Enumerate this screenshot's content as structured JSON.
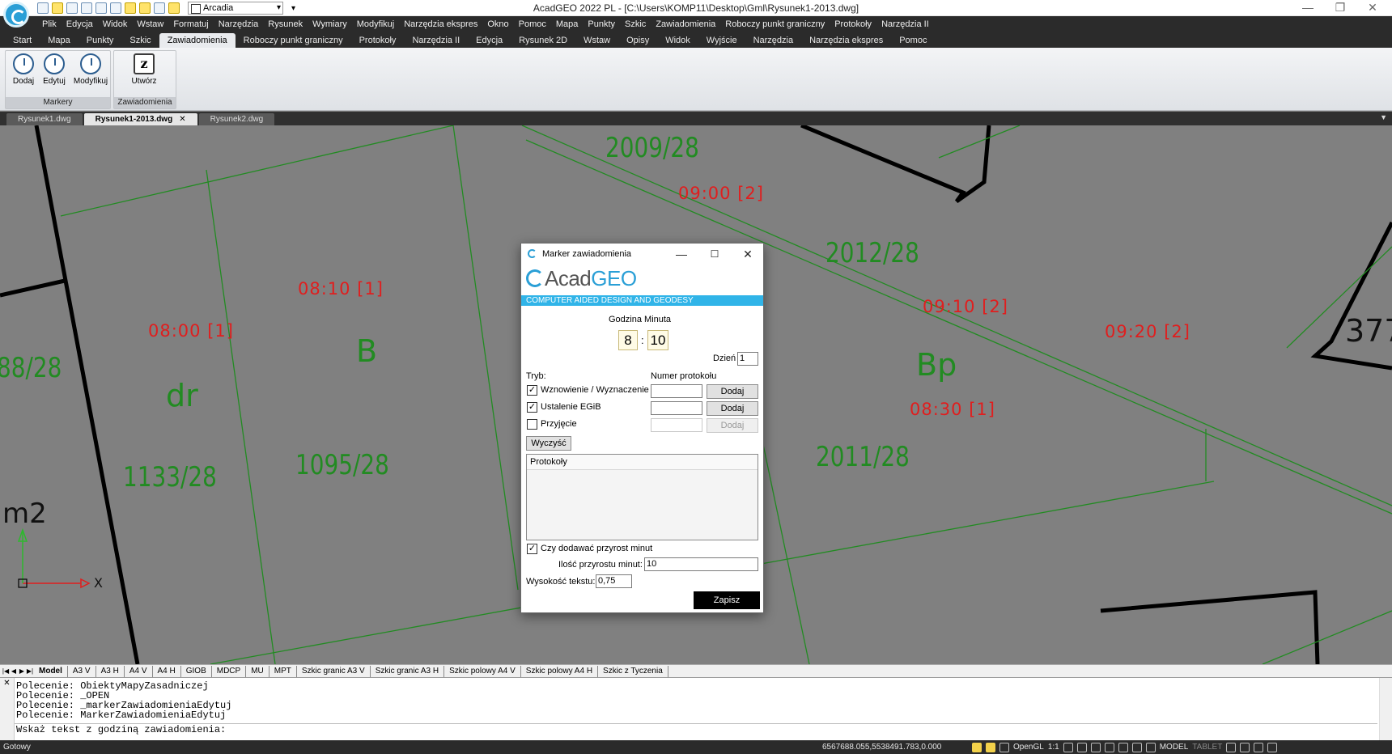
{
  "window": {
    "title": "AcadGEO 2022 PL - [C:\\Users\\KOMP11\\Desktop\\Gml\\Rysunek1-2013.dwg]",
    "layer_value": "Arcadia",
    "qat_more": "▾",
    "minimize": "—",
    "maximize": "❐",
    "close": "✕"
  },
  "menu": [
    "Plik",
    "Edycja",
    "Widok",
    "Wstaw",
    "Formatuj",
    "Narzędzia",
    "Rysunek",
    "Wymiary",
    "Modyfikuj",
    "Narzędzia ekspres",
    "Okno",
    "Pomoc",
    "Mapa",
    "Punkty",
    "Szkic",
    "Zawiadomienia",
    "Roboczy punkt graniczny",
    "Protokoły",
    "Narzędzia II"
  ],
  "ribbon_tabs": [
    "Start",
    "Mapa",
    "Punkty",
    "Szkic",
    "Zawiadomienia",
    "Roboczy punkt graniczny",
    "Protokoły",
    "Narzędzia II",
    "Edycja",
    "Rysunek 2D",
    "Wstaw",
    "Opisy",
    "Widok",
    "Wyjście",
    "Narzędzia",
    "Narzędzia ekspres",
    "Pomoc"
  ],
  "ribbon": {
    "markery": {
      "title": "Markery",
      "buttons": [
        "Dodaj",
        "Edytuj",
        "Modyfikuj"
      ]
    },
    "zawiadomienia": {
      "title": "Zawiadomienia",
      "buttons": [
        "Utwórz"
      ]
    }
  },
  "doc_tabs": [
    {
      "label": "Rysunek1.dwg",
      "active": false
    },
    {
      "label": "Rysunek1-2013.dwg",
      "active": true,
      "close": "✕"
    },
    {
      "label": "Rysunek2.dwg",
      "active": false
    }
  ],
  "drawing": {
    "parcels": [
      "2009/28",
      "2012/28",
      "2011/28",
      "1095/28",
      "1133/28",
      "88/28",
      "377"
    ],
    "land_use": [
      "B",
      "dr",
      "Bp"
    ],
    "notice_times": [
      "09:00 [2]",
      "08:10 [1]",
      "08:00 [1]",
      "09:10 [2]",
      "09:20 [2]",
      "08:30 [1]"
    ],
    "unit_label": "m2",
    "ucs_x": "X"
  },
  "layout_tabs": [
    "Model",
    "A3 V",
    "A3 H",
    "A4 V",
    "A4 H",
    "GIOB",
    "MDCP",
    "MU",
    "MPT",
    "Szkic granic A3 V",
    "Szkic granic A3 H",
    "Szkic polowy A4 V",
    "Szkic polowy A4 H",
    "Szkic z Tyczenia"
  ],
  "command_line": {
    "history": [
      "Polecenie: ObiektyMapyZasadniczej",
      "Polecenie: _OPEN",
      "Polecenie: _markerZawiadomieniaEdytuj",
      "Polecenie: MarkerZawiadomieniaEdytuj"
    ],
    "prompt": "Wskaż tekst z godziną zawiadomienia:"
  },
  "status": {
    "ready": "Gotowy",
    "coords": "6567688.055,5538491.783,0.000",
    "graphics": "OpenGL",
    "scale": "1:1",
    "model": "MODEL",
    "tablet": "TABLET"
  },
  "dialog": {
    "title": "Marker zawiadomienia",
    "brand_acad": "Acad",
    "brand_geo": "GEO",
    "banner": "COMPUTER AIDED DESIGN AND GEODESY",
    "time_label": "Godzina Minuta",
    "hour": "8",
    "separator": ":",
    "minute": "10",
    "day_label": "Dzień",
    "day": "1",
    "mode_label": "Tryb:",
    "protocol_number_label": "Numer protokołu",
    "modes": [
      {
        "label": "Wznowienie / Wyznaczenie",
        "checked": true,
        "button": "Dodaj"
      },
      {
        "label": "Ustalenie EGiB",
        "checked": true,
        "button": "Dodaj"
      },
      {
        "label": "Przyjęcie",
        "checked": false,
        "button": "Dodaj"
      }
    ],
    "clear_button": "Wyczyść",
    "protocols_header": "Protokoły",
    "add_increment_label": "Czy dodawać przyrost minut",
    "add_increment_checked": true,
    "increment_label": "Ilość przyrostu minut:",
    "increment_value": "10",
    "text_height_label": "Wysokość tekstu:",
    "text_height_value": "0,75",
    "save_button": "Zapisz"
  },
  "colors": {
    "accent": "#2a9fd6",
    "banner": "#30b4e8",
    "line_green": "#228b22",
    "text_red": "#e01e1e",
    "canvas": "#808080"
  }
}
